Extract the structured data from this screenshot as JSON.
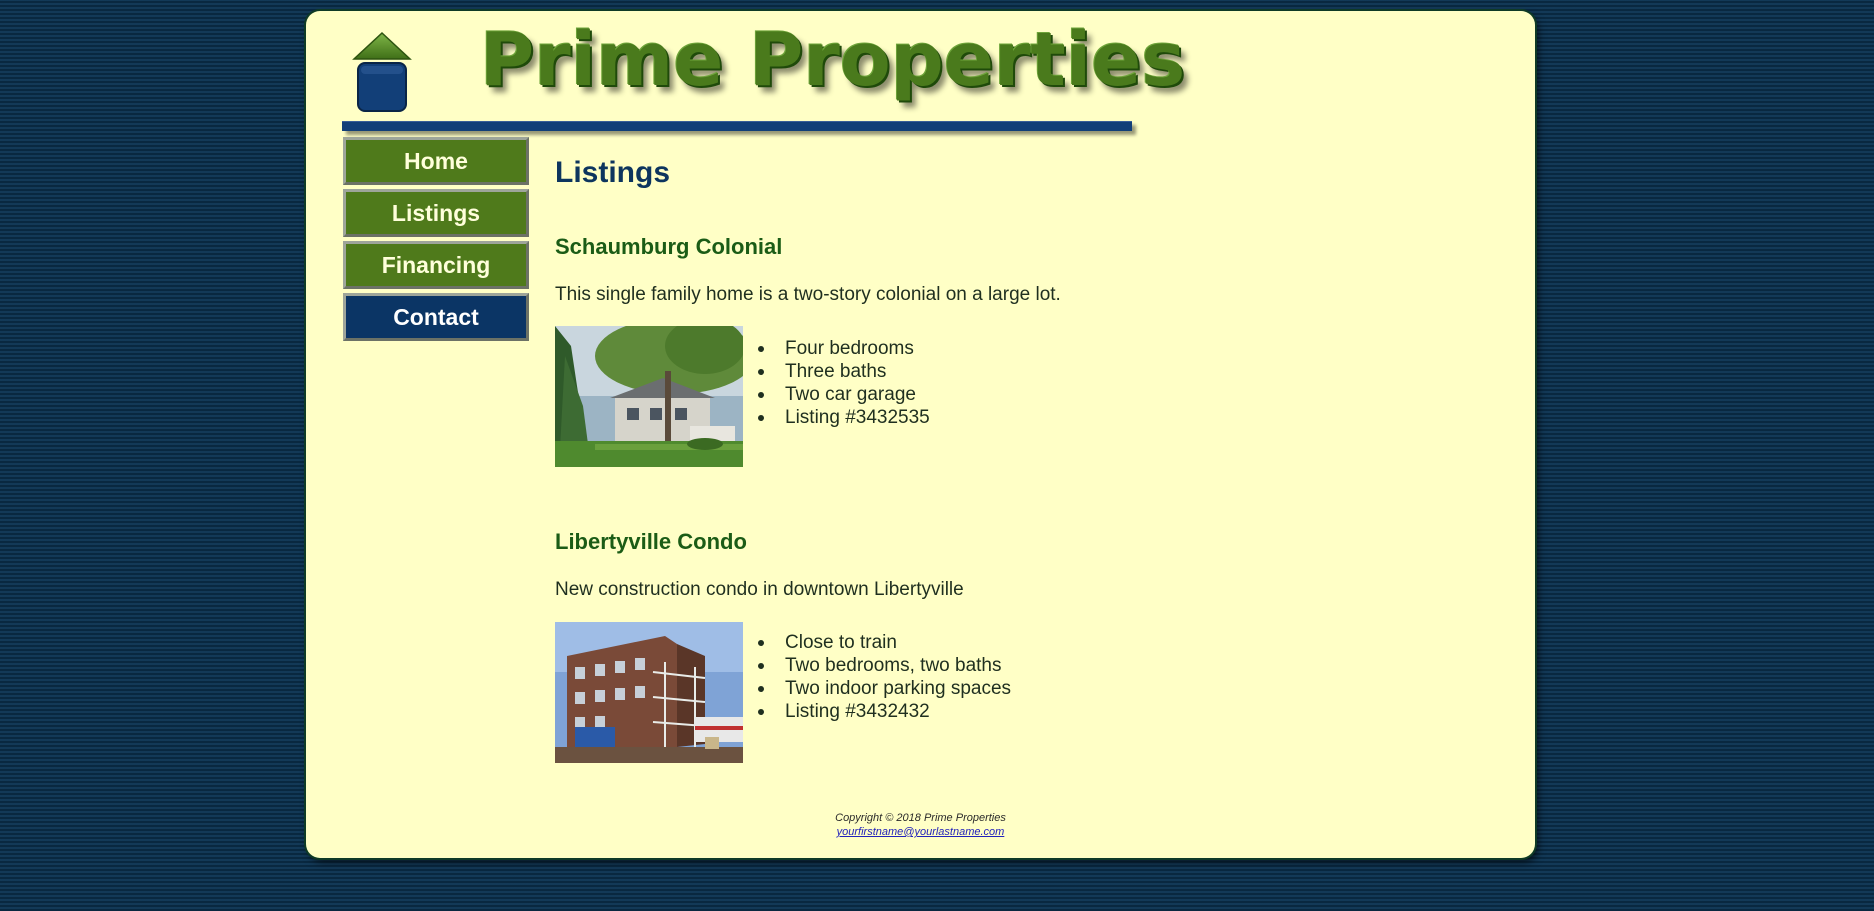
{
  "brand": {
    "name": "Prime Properties",
    "logo_icon": "house-icon",
    "colors": {
      "page_bg": "#0b3352",
      "panel_bg": "#ffffc6",
      "logo_green": "#4a7a1c",
      "accent_blue": "#123f78",
      "nav_green": "#4f7a1b",
      "nav_active": "#0b3565"
    }
  },
  "nav": {
    "items": [
      {
        "label": "Home",
        "active": false
      },
      {
        "label": "Listings",
        "active": false
      },
      {
        "label": "Financing",
        "active": false
      },
      {
        "label": "Contact",
        "active": true
      }
    ]
  },
  "main": {
    "title": "Listings",
    "listings": [
      {
        "title": "Schaumburg Colonial",
        "description": "This single family home is a two-story colonial on a large lot.",
        "photo": "colonial-house-photo",
        "features": [
          "Four bedrooms",
          "Three baths",
          "Two car garage",
          "Listing #3432535"
        ]
      },
      {
        "title": "Libertyville Condo",
        "description": "New construction condo in downtown Libertyville",
        "photo": "condo-building-photo",
        "features": [
          "Close to train",
          "Two bedrooms, two baths",
          "Two indoor parking spaces",
          "Listing #3432432"
        ]
      }
    ]
  },
  "footer": {
    "copyright": "Copyright © 2018 Prime Properties",
    "email": "yourfirstname@yourlastname.com"
  }
}
